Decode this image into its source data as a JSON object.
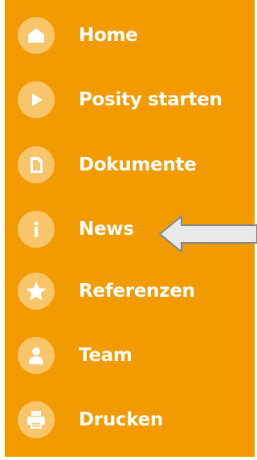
{
  "sidebar": {
    "background_color": "#f29b00",
    "icon_circle_color": "#f8c56b",
    "items": [
      {
        "label": "Home",
        "icon": "home-icon"
      },
      {
        "label": "Posity starten",
        "icon": "play-icon"
      },
      {
        "label": "Dokumente",
        "icon": "document-icon"
      },
      {
        "label": "News",
        "icon": "info-icon"
      },
      {
        "label": "Referenzen",
        "icon": "star-icon"
      },
      {
        "label": "Team",
        "icon": "person-icon"
      },
      {
        "label": "Drucken",
        "icon": "printer-icon"
      }
    ]
  },
  "annotation": {
    "arrow_icon": "left-arrow-icon",
    "arrow_fill": "#e9e9e9",
    "arrow_stroke": "#7f8a8f"
  }
}
